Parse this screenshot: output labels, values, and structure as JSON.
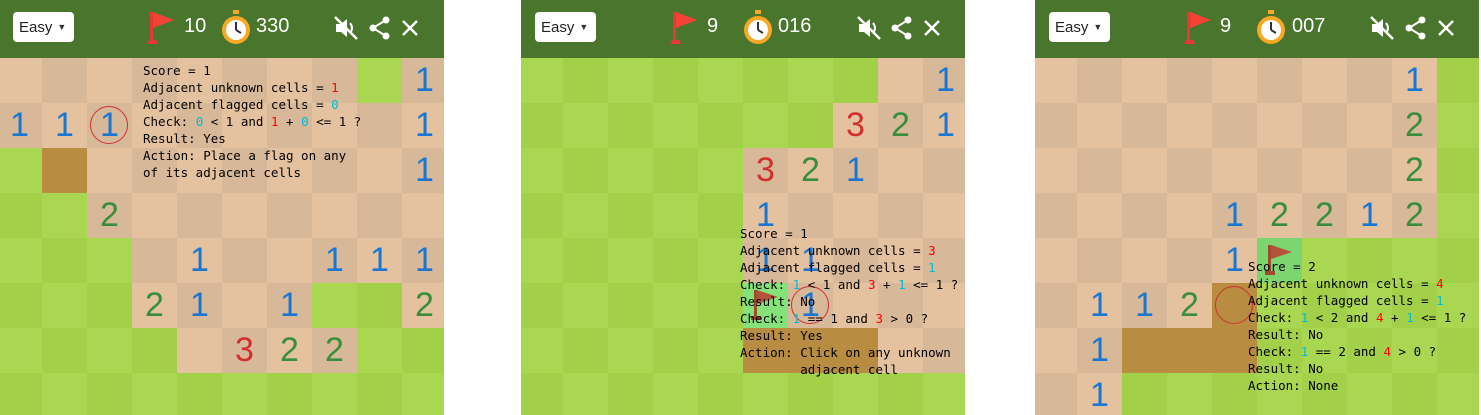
{
  "panels": [
    {
      "difficulty": "Easy",
      "flags": "10",
      "timer": "330",
      "overlay": {
        "score": "Score = 1",
        "unknown_label": "Adjacent unknown cells = ",
        "unknown_val": "1",
        "flagged_label": "Adjacent flagged cells = ",
        "flagged_val": "0",
        "check_prefix": "Check: ",
        "check_a": "0",
        "check_mid": " < 1 and ",
        "check_b": "1",
        "check_plus": " + ",
        "check_c": "0",
        "check_end": " <= 1 ?",
        "result": "Result: Yes",
        "action_1": "Action: Place a flag on any",
        "action_2": "of its adjacent cells"
      }
    },
    {
      "difficulty": "Easy",
      "flags": "9",
      "timer": "016",
      "overlay": {
        "score": "Score = 1",
        "unknown_label": "Adjacent unknown cells = ",
        "unknown_val": "3",
        "flagged_label": "Adjacent flagged cells = ",
        "flagged_val": "1",
        "check1_prefix": "Check: ",
        "check1_a": "1",
        "check1_mid": " < 1 and ",
        "check1_b": "3",
        "check1_plus": " + ",
        "check1_c": "1",
        "check1_end": " <= 1 ?",
        "result1": "Result: No",
        "check2_prefix": "Check: ",
        "check2_a": "1",
        "check2_mid": " == 1 and ",
        "check2_b": "3",
        "check2_end": " > 0 ?",
        "result2": "Result: Yes",
        "action_1": "Action: Click on any unknown",
        "action_2": "        adjacent cell"
      }
    },
    {
      "difficulty": "Easy",
      "flags": "9",
      "timer": "007",
      "overlay": {
        "score": "Score = 2",
        "unknown_label": "Adjacent unknown cells = ",
        "unknown_val": "4",
        "flagged_label": "Adjacent flagged cells = ",
        "flagged_val": "1",
        "check1_prefix": "Check: ",
        "check1_a": "1",
        "check1_mid": " < 2 and ",
        "check1_b": "4",
        "check1_plus": " + ",
        "check1_c": "1",
        "check1_end": " <= 1 ?",
        "result1": "Result: No",
        "check2_prefix": "Check: ",
        "check2_a": "1",
        "check2_mid": " == 2 and ",
        "check2_b": "4",
        "check2_end": " > 0 ?",
        "result2": "Result: No",
        "action": "Action: None"
      }
    }
  ],
  "colors": {
    "header": "#4a752c",
    "grass_light": "#aad751",
    "grass_dark": "#a2d149",
    "dirt_light": "#e5c29f",
    "dirt_dark": "#d7b899",
    "highlight_circle": "#d32f2f",
    "n1": "#1976d2",
    "n2": "#388e3c",
    "n3": "#d32f2f"
  },
  "icons": [
    "flag-icon",
    "stopwatch-icon",
    "sound-off-icon",
    "share-icon",
    "close-icon"
  ]
}
